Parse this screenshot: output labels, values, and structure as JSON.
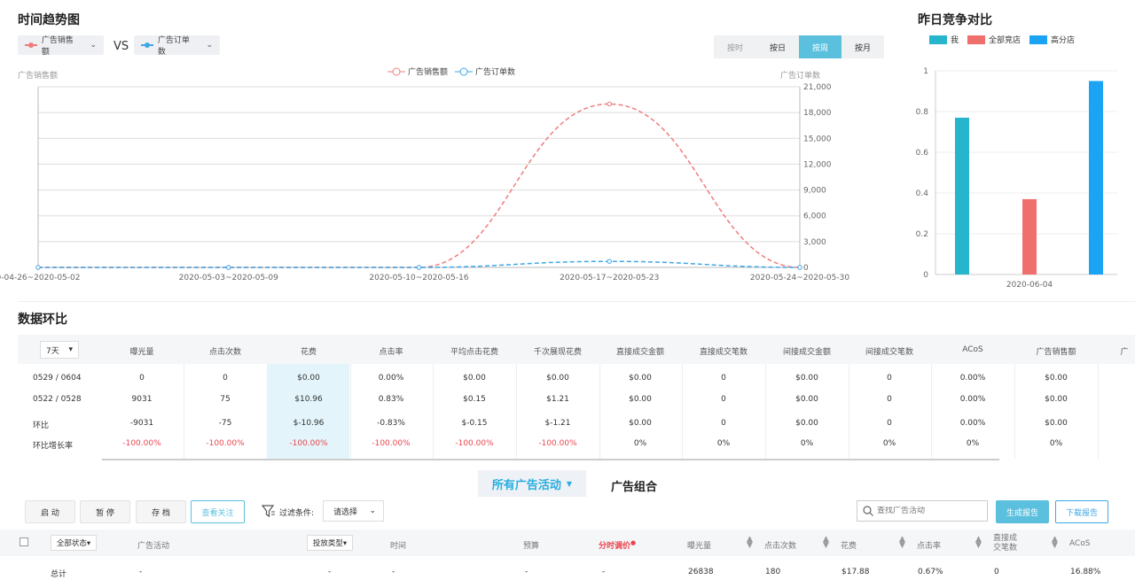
{
  "trend": {
    "title": "时间趋势图",
    "metric_left": "广告销售额",
    "vs_label": "VS",
    "metric_right": "广告订单数",
    "left_color": "#f07c7c",
    "right_color": "#3fa7e8",
    "granularity": [
      "按时",
      "按日",
      "按周",
      "按月"
    ],
    "granularity_active": "按周",
    "y_left_label": "广告销售额",
    "y_right_label": "广告订单数",
    "legend": [
      "广告销售额",
      "广告订单数"
    ]
  },
  "chart_data": [
    {
      "type": "line",
      "title": "时间趋势图",
      "x": [
        "0-04-26~2020-05-02",
        "2020-05-03~2020-05-09",
        "2020-05-10~2020-05-16",
        "2020-05-17~2020-05-23",
        "2020-05-24~2020-05-30"
      ],
      "series": [
        {
          "name": "广告销售额",
          "values": [
            0,
            0,
            0,
            19000,
            0
          ]
        },
        {
          "name": "广告订单数",
          "values": [
            0,
            0,
            0,
            700,
            0
          ]
        }
      ],
      "y_right_ticks": [
        "21,000",
        "18,000",
        "15,000",
        "12,000",
        "9,000",
        "6,000",
        "3,000",
        "0"
      ],
      "ylim": [
        0,
        21000
      ]
    },
    {
      "type": "bar",
      "title": "昨日竞争对比",
      "categories": [
        "2020-06-04"
      ],
      "series": [
        {
          "name": "我",
          "values": [
            0.77
          ],
          "color": "#26b5cc"
        },
        {
          "name": "全部竞店",
          "values": [
            0.37
          ],
          "color": "#ef6f6c"
        },
        {
          "name": "高分店",
          "values": [
            0.95
          ],
          "color": "#1aa4f3"
        }
      ],
      "y_ticks": [
        "1",
        "0.8",
        "0.6",
        "0.4",
        "0.2",
        "0"
      ],
      "ylim": [
        0,
        1
      ]
    }
  ],
  "data_section": {
    "title": "数据环比",
    "period_select": "7天",
    "columns": [
      "曝光量",
      "点击次数",
      "花费",
      "点击率",
      "平均点击花费",
      "千次展现花费",
      "直接成交金额",
      "直接成交笔数",
      "间接成交金额",
      "间接成交笔数",
      "ACoS",
      "广告销售额",
      "广"
    ],
    "rows": [
      {
        "label": "0529 / 0604",
        "values": [
          "0",
          "0",
          "$0.00",
          "0.00%",
          "$0.00",
          "$0.00",
          "$0.00",
          "0",
          "$0.00",
          "0",
          "0.00%",
          "$0.00"
        ]
      },
      {
        "label": "0522 / 0528",
        "values": [
          "9031",
          "75",
          "$10.96",
          "0.83%",
          "$0.15",
          "$1.21",
          "$0.00",
          "0",
          "$0.00",
          "0",
          "0.00%",
          "$0.00"
        ]
      },
      {
        "label": "环比",
        "values": [
          "-9031",
          "-75",
          "$-10.96",
          "-0.83%",
          "$-0.15",
          "$-1.21",
          "$0.00",
          "0",
          "$0.00",
          "0",
          "0.00%",
          "$0.00"
        ]
      },
      {
        "label": "环比增长率",
        "values": [
          "-100.00%",
          "-100.00%",
          "-100.00%",
          "-100.00%",
          "-100.00%",
          "-100.00%",
          "0%",
          "0%",
          "0%",
          "0%",
          "0%",
          "0%"
        ]
      }
    ]
  },
  "tabs": {
    "campaigns": "所有广告活动",
    "groups": "广告组合"
  },
  "toolbar": {
    "start": "启 动",
    "pause": "暂 停",
    "archive": "存 档",
    "watch": "查看关注",
    "filter_label": "过滤条件:",
    "filter_select": "请选择",
    "search_placeholder": "查找广告活动",
    "report": "生成报告",
    "download": "下载报告"
  },
  "list": {
    "headers": {
      "status": "全部状态▾",
      "campaign": "广告活动",
      "type": "投放类型▾",
      "time": "时间",
      "budget": "预算",
      "hourly": "分时调价",
      "impr": "曝光量",
      "clicks": "点击次数",
      "spend": "花费",
      "ctr": "点击率",
      "direct1": "直接成",
      "direct2": "交笔数",
      "acos": "ACoS"
    },
    "total": {
      "label": "总计",
      "dash": "-",
      "impr": "26838",
      "clicks": "180",
      "spend": "$17.88",
      "ctr": "0.67%",
      "orders": "0",
      "acos": "16.88%"
    }
  }
}
